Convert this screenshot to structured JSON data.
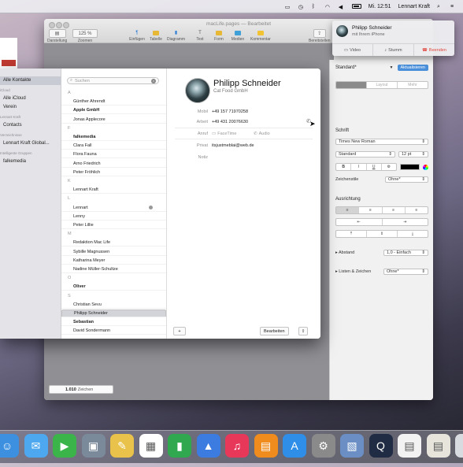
{
  "menubar": {
    "clock": "Mi. 12:51",
    "user": "Lennart Kraft"
  },
  "pages": {
    "title": "macLife.pages — Bearbeitet",
    "toolbar": [
      {
        "label": "Darstellung",
        "icon": "sidebar-icon"
      },
      {
        "label": "Zoomen",
        "value": "125 %"
      },
      {
        "label": "Einfügen",
        "icon": "paragraph-icon"
      },
      {
        "label": "Tabelle",
        "icon": "table-icon"
      },
      {
        "label": "Diagramm",
        "icon": "chart-icon"
      },
      {
        "label": "Text",
        "icon": "text-icon"
      },
      {
        "label": "Form",
        "icon": "shape-icon"
      },
      {
        "label": "Medien",
        "icon": "media-icon"
      },
      {
        "label": "Kommentar",
        "icon": "comment-icon"
      },
      {
        "label": "Bereitstellen",
        "icon": "share-icon"
      }
    ],
    "word_count": {
      "number": "1.010",
      "label": "Zeichen"
    },
    "inspector": {
      "style_name": "Standard*",
      "update_button": "Aktualisieren",
      "tabs": [
        "Stil",
        "Layout",
        "Mehr"
      ],
      "font_heading": "Schrift",
      "font_family": "Times New Roman",
      "font_style": "Standard",
      "font_size": "12 pt",
      "char_styles_label": "Zeichenstile",
      "char_styles_value": "Ohne*",
      "alignment_heading": "Ausrichtung",
      "spacing_label": "Abstand",
      "spacing_value": "1,0 - Einfach",
      "bullets_label": "Listen & Zeichen",
      "bullets_value": "Ohne*"
    }
  },
  "contacts": {
    "sidebar": [
      {
        "type": "item",
        "label": "Alle Kontakte",
        "selected": true
      },
      {
        "type": "head",
        "label": "iCloud"
      },
      {
        "type": "item",
        "label": "Alle iCloud"
      },
      {
        "type": "item",
        "label": "Verein"
      },
      {
        "type": "head",
        "label": "Lennart Kraft"
      },
      {
        "type": "item",
        "label": "Contacts"
      },
      {
        "type": "head",
        "label": "Verzeichnisse"
      },
      {
        "type": "item",
        "label": "Lennart Kraft Global..."
      },
      {
        "type": "head",
        "label": "Intelligente Gruppen"
      },
      {
        "type": "item",
        "label": "falkemedia"
      }
    ],
    "search_placeholder": "Suchen",
    "list": [
      {
        "kind": "letter",
        "text": "A"
      },
      {
        "kind": "item",
        "text": "Günther Ahrendt"
      },
      {
        "kind": "item",
        "text": "Apple GmbH",
        "bold": true
      },
      {
        "kind": "item",
        "text": "Jonas Applecore"
      },
      {
        "kind": "letter",
        "text": "F"
      },
      {
        "kind": "item",
        "text": "falkemedia",
        "bold": true
      },
      {
        "kind": "item",
        "text": "Clara Fall"
      },
      {
        "kind": "item",
        "text": "Flora Fauna"
      },
      {
        "kind": "item",
        "text": "Arno Friedrich"
      },
      {
        "kind": "item",
        "text": "Peter Fröhlich"
      },
      {
        "kind": "letter",
        "text": "K"
      },
      {
        "kind": "item",
        "text": "Lennart Kraft"
      },
      {
        "kind": "letter",
        "text": "L"
      },
      {
        "kind": "item",
        "text": "Lennart",
        "me": true
      },
      {
        "kind": "item",
        "text": "Lenny"
      },
      {
        "kind": "item",
        "text": "Peter Lillie"
      },
      {
        "kind": "letter",
        "text": "M"
      },
      {
        "kind": "item",
        "text": "Redaktion Mac Life"
      },
      {
        "kind": "item",
        "text": "Sybille Magnussen"
      },
      {
        "kind": "item",
        "text": "Katharina Meyer"
      },
      {
        "kind": "item",
        "text": "Nadine Müller-Schultze"
      },
      {
        "kind": "letter",
        "text": "O"
      },
      {
        "kind": "item",
        "text": "Oliver",
        "bold": true
      },
      {
        "kind": "letter",
        "text": "S"
      },
      {
        "kind": "item",
        "text": "Christian Sevu"
      },
      {
        "kind": "item",
        "text": "Philipp Schneider",
        "selected": true
      },
      {
        "kind": "item",
        "text": "Sebastian",
        "bold": true
      },
      {
        "kind": "item",
        "text": "David Sondermann"
      }
    ],
    "detail": {
      "name": "Philipp Schneider",
      "company": "Cat Food GmbH",
      "fields": [
        {
          "label": "Mobil",
          "value": "+49 157 71970258"
        },
        {
          "label": "Arbeit",
          "value": "+49 431 20076630"
        }
      ],
      "actions": {
        "label": "Anruf",
        "facetime": "FaceTime",
        "audio": "Audio"
      },
      "private_label": "Privat",
      "private_value": "itsjustmeblai@web.de",
      "note_label": "Notiz",
      "add_button": "+",
      "edit_button": "Bearbeiten"
    }
  },
  "notification": {
    "title": "Philipp Schneider",
    "subtitle": "mit Ihrem iPhone",
    "video": "Video",
    "mute": "Stumm",
    "end": "Beenden"
  },
  "dock": [
    {
      "name": "finder-icon",
      "color": "#3d8fe0"
    },
    {
      "name": "messages-icon",
      "color": "#4ea8f0"
    },
    {
      "name": "facetime-icon",
      "color": "#3bb54a"
    },
    {
      "name": "photos-icon",
      "color": "#7a8a9a"
    },
    {
      "name": "notes-icon",
      "color": "#e8c24a"
    },
    {
      "name": "calendar-icon",
      "color": "#ffffff"
    },
    {
      "name": "numbers-icon",
      "color": "#2fa84f"
    },
    {
      "name": "keynote-icon",
      "color": "#3c7be0"
    },
    {
      "name": "itunes-icon",
      "color": "#e8385a"
    },
    {
      "name": "ibooks-icon",
      "color": "#f08c1e"
    },
    {
      "name": "appstore-icon",
      "color": "#2f8fe8"
    },
    {
      "name": "system-preferences-icon",
      "color": "#8a8a8a"
    },
    {
      "name": "preview-icon",
      "color": "#6b8fc4"
    },
    {
      "name": "quicktime-icon",
      "color": "#1f2c44"
    },
    {
      "name": "document-icon",
      "color": "#f2f2f2"
    },
    {
      "name": "document2-icon",
      "color": "#e7e4dc"
    },
    {
      "name": "trash-icon",
      "color": "#d8dbe0"
    }
  ]
}
